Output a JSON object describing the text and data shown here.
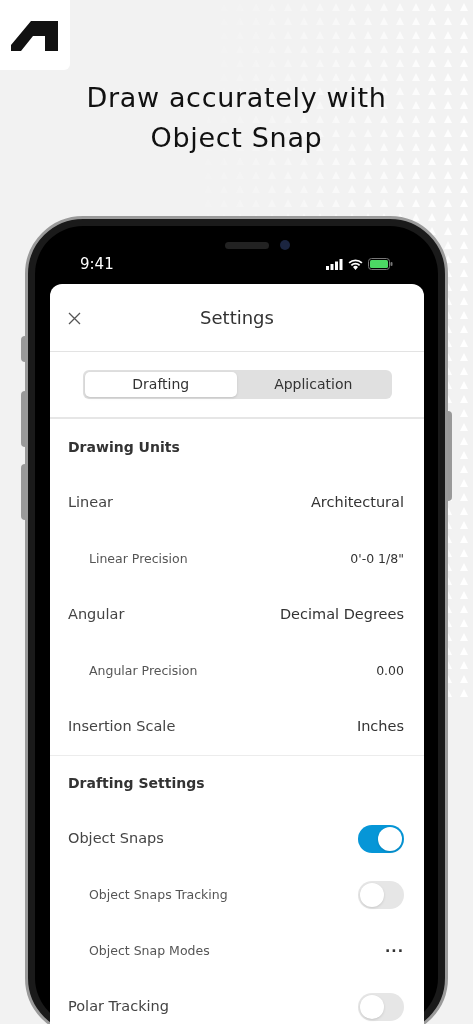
{
  "headline": "Draw accurately with Object Snap",
  "status_bar": {
    "time": "9:41"
  },
  "sheet": {
    "title": "Settings",
    "tabs": [
      {
        "label": "Drafting",
        "selected": true
      },
      {
        "label": "Application",
        "selected": false
      }
    ],
    "sections": [
      {
        "header": "Drawing Units",
        "rows": [
          {
            "kind": "value",
            "label": "Linear",
            "value": "Architectural",
            "children": [
              {
                "kind": "value",
                "label": "Linear Precision",
                "value": "0'-0 1/8\""
              }
            ]
          },
          {
            "kind": "value",
            "label": "Angular",
            "value": "Decimal Degrees",
            "children": [
              {
                "kind": "value",
                "label": "Angular Precision",
                "value": "0.00"
              }
            ]
          },
          {
            "kind": "value",
            "label": "Insertion Scale",
            "value": "Inches"
          }
        ]
      },
      {
        "header": "Drafting Settings",
        "rows": [
          {
            "kind": "toggle",
            "label": "Object Snaps",
            "on": true,
            "children": [
              {
                "kind": "toggle",
                "label": "Object Snaps Tracking",
                "on": false
              },
              {
                "kind": "more",
                "label": "Object Snap Modes",
                "value": "···"
              }
            ]
          },
          {
            "kind": "toggle",
            "label": "Polar Tracking",
            "on": false
          }
        ]
      }
    ]
  }
}
